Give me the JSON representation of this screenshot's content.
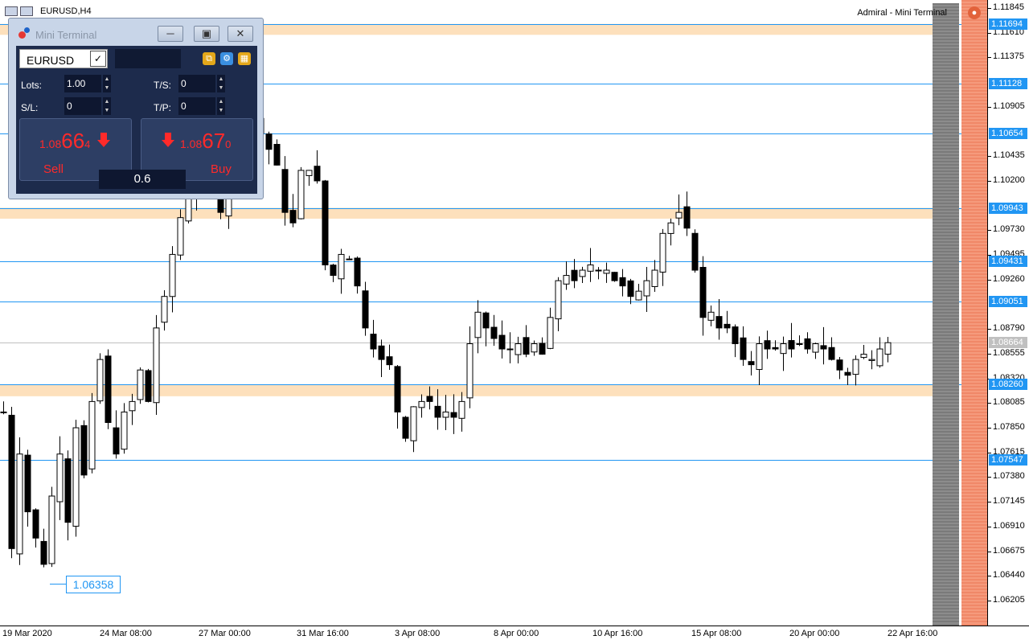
{
  "chart": {
    "title": "EURUSD,H4",
    "broker_label": "Admiral - Mini Terminal",
    "broker_icon": "admiral-logo-icon",
    "low_marker": "1.06358"
  },
  "price_axis": {
    "ticks": [
      "1.11845",
      "1.11610",
      "1.11375",
      "1.10905",
      "1.10435",
      "1.10200",
      "1.09730",
      "1.09495",
      "1.09260",
      "1.08790",
      "1.08555",
      "1.08320",
      "1.08085",
      "1.07850",
      "1.07615",
      "1.07380",
      "1.07145",
      "1.06910",
      "1.06675",
      "1.06440",
      "1.06205"
    ],
    "tags": [
      "1.11694",
      "1.11128",
      "1.10654",
      "1.09943",
      "1.09431",
      "1.09051",
      "1.08260",
      "1.07547"
    ],
    "current": "1.08664"
  },
  "time_axis": {
    "labels": [
      "19 Mar 2020",
      "24 Mar 08:00",
      "27 Mar 00:00",
      "31 Mar 16:00",
      "3 Apr 08:00",
      "8 Apr 00:00",
      "10 Apr 16:00",
      "15 Apr 08:00",
      "20 Apr 00:00",
      "22 Apr 16:00"
    ]
  },
  "colors": {
    "level_line": "#2196f3",
    "zone": "#fde0bc",
    "bull_candle": "#ffffff",
    "bear_candle": "#000000"
  },
  "mini_terminal": {
    "title": "Mini Terminal",
    "minimize_icon": "minimize-icon",
    "maximize_icon": "maximize-icon",
    "close_icon": "close-icon",
    "symbol": "EURUSD",
    "lots_label": "Lots:",
    "lots_value": "1.00",
    "sl_label": "S/L:",
    "sl_value": "0",
    "ts_label": "T/S:",
    "ts_value": "0",
    "tp_label": "T/P:",
    "tp_value": "0",
    "sell": {
      "prefix": "1.08",
      "big": "66",
      "sup": "4",
      "label": "Sell"
    },
    "buy": {
      "prefix": "1.08",
      "big": "67",
      "sup": "0",
      "label": "Buy"
    },
    "spread": "0.6"
  }
}
